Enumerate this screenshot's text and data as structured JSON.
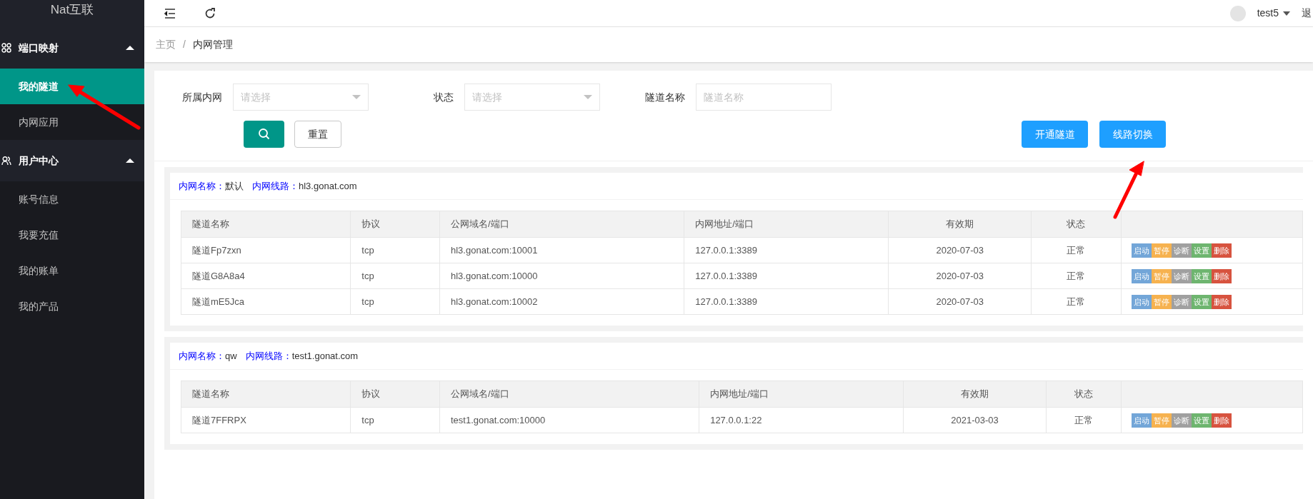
{
  "sidebar": {
    "logo": "Nat互联",
    "groups": [
      {
        "kind": "grid",
        "label": "端口映射",
        "expanded": true,
        "items": [
          {
            "label": "我的隧道",
            "selected": true
          },
          {
            "label": "内网应用",
            "selected": false
          }
        ]
      },
      {
        "kind": "user",
        "label": "用户中心",
        "expanded": true,
        "items": [
          {
            "label": "账号信息",
            "selected": false
          },
          {
            "label": "我要充值",
            "selected": false
          },
          {
            "label": "我的账单",
            "selected": false
          },
          {
            "label": "我的产品",
            "selected": false
          }
        ]
      }
    ]
  },
  "header": {
    "user": "test5",
    "logout": "退"
  },
  "breadcrumb": [
    "主页",
    "/",
    "内网管理"
  ],
  "filters": [
    {
      "label": "所属内网",
      "kind": "select",
      "placeholder": "请选择"
    },
    {
      "label": "状态",
      "kind": "select",
      "placeholder": "请选择"
    },
    {
      "label": "隧道名称",
      "kind": "text",
      "placeholder": "隧道名称"
    }
  ],
  "reset_button": "重置",
  "action_buttons": [
    "开通隧道",
    "线路切换"
  ],
  "networks": [
    {
      "name_label": "内网名称：",
      "name": "默认",
      "line_label": "内网线路：",
      "line": "hl3.gonat.com",
      "columns": [
        "隧道名称",
        "协议",
        "公网域名/端口",
        "内网地址/端口",
        "有效期",
        "状态"
      ],
      "rows": [
        {
          "cells": [
            "隧道Fp7zxn",
            "tcp",
            "hl3.gonat.com:10001",
            "127.0.0.1:3389",
            "2020-07-03",
            "正常"
          ],
          "actions": [
            {
              "label": "启动",
              "color": "#73a6d8"
            },
            {
              "label": "暂停",
              "color": "#f6b24f"
            },
            {
              "label": "诊断",
              "color": "#a0a0a0"
            },
            {
              "label": "设置",
              "color": "#6eb56f"
            },
            {
              "label": "删除",
              "color": "#d7533f"
            }
          ]
        },
        {
          "cells": [
            "隧道G8A8a4",
            "tcp",
            "hl3.gonat.com:10000",
            "127.0.0.1:3389",
            "2020-07-03",
            "正常"
          ],
          "actions": [
            {
              "label": "启动",
              "color": "#73a6d8"
            },
            {
              "label": "暂停",
              "color": "#f6b24f"
            },
            {
              "label": "诊断",
              "color": "#a0a0a0"
            },
            {
              "label": "设置",
              "color": "#6eb56f"
            },
            {
              "label": "删除",
              "color": "#d7533f"
            }
          ]
        },
        {
          "cells": [
            "隧道mE5Jca",
            "tcp",
            "hl3.gonat.com:10002",
            "127.0.0.1:3389",
            "2020-07-03",
            "正常"
          ],
          "actions": [
            {
              "label": "启动",
              "color": "#73a6d8"
            },
            {
              "label": "暂停",
              "color": "#f6b24f"
            },
            {
              "label": "诊断",
              "color": "#a0a0a0"
            },
            {
              "label": "设置",
              "color": "#6eb56f"
            },
            {
              "label": "删除",
              "color": "#d7533f"
            }
          ]
        }
      ]
    },
    {
      "name_label": "内网名称：",
      "name": "qw",
      "line_label": "内网线路：",
      "line": "test1.gonat.com",
      "columns": [
        "隧道名称",
        "协议",
        "公网域名/端口",
        "内网地址/端口",
        "有效期",
        "状态"
      ],
      "rows": [
        {
          "cells": [
            "隧道7FFRPX",
            "tcp",
            "test1.gonat.com:10000",
            "127.0.0.1:22",
            "2021-03-03",
            "正常"
          ],
          "actions": [
            {
              "label": "启动",
              "color": "#73a6d8"
            },
            {
              "label": "暂停",
              "color": "#f6b24f"
            },
            {
              "label": "诊断",
              "color": "#a0a0a0"
            },
            {
              "label": "设置",
              "color": "#6eb56f"
            },
            {
              "label": "删除",
              "color": "#d7533f"
            }
          ]
        }
      ]
    }
  ]
}
